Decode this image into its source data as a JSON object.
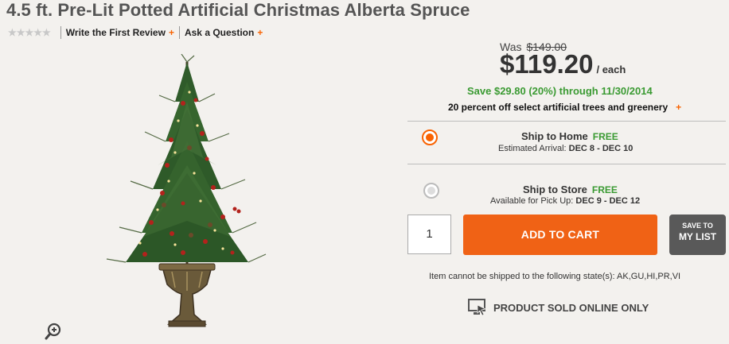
{
  "product": {
    "title": "4.5 ft. Pre-Lit Potted Artificial Christmas Alberta Spruce"
  },
  "reviews": {
    "stars": "★★★★★",
    "write_review_label": "Write the First Review",
    "ask_question_label": "Ask a Question",
    "plus": "+"
  },
  "pricing": {
    "was_label": "Was",
    "was_price": "$149.00",
    "price": "$119.20",
    "unit": "/ each",
    "savings": "Save $29.80 (20%) through 11/30/2014",
    "promo": "20 percent off select artificial trees and greenery",
    "promo_plus": "+"
  },
  "shipping": {
    "home": {
      "title": "Ship to Home",
      "badge": "FREE",
      "sub_label": "Estimated Arrival:",
      "sub_value": "DEC 8 - DEC 10",
      "selected": true
    },
    "store": {
      "title": "Ship to Store",
      "badge": "FREE",
      "sub_label": "Available for Pick Up:",
      "sub_value": "DEC 9 - DEC 12",
      "selected": false
    }
  },
  "cart": {
    "quantity": "1",
    "add_label": "ADD TO CART",
    "save_line1": "SAVE TO",
    "save_line2": "MY LIST"
  },
  "notice": "Item cannot be shipped to the following state(s): AK,GU,HI,PR,VI",
  "online_only": "PRODUCT SOLD ONLINE ONLY",
  "colors": {
    "accent": "#f96302",
    "free_green": "#3a9a32",
    "background": "#f3f1ee"
  },
  "icons": {
    "zoom": "zoom-in-icon",
    "online": "monitor-icon"
  }
}
